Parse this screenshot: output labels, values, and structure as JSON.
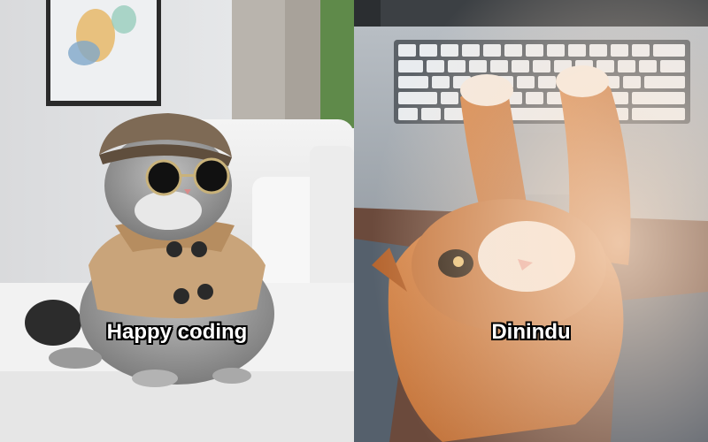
{
  "meme": {
    "left_caption": "Happy coding",
    "right_caption": "Dinindu"
  }
}
